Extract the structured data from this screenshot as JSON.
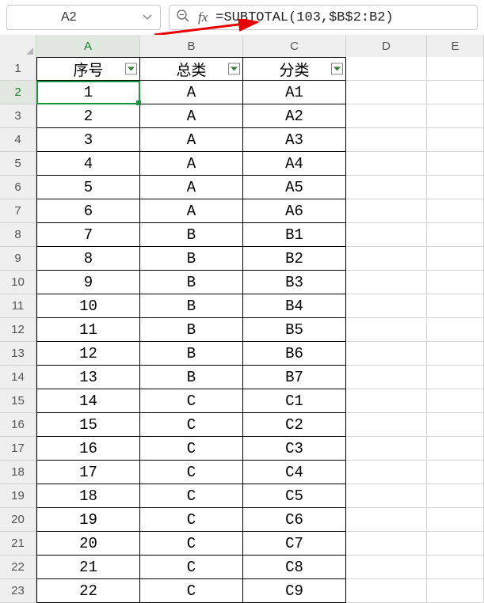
{
  "namebox": {
    "value": "A2"
  },
  "formula": {
    "text": "=SUBTOTAL(103,$B$2:B2)"
  },
  "columns": [
    "A",
    "B",
    "C",
    "D",
    "E"
  ],
  "headers": {
    "A": "序号",
    "B": "总类",
    "C": "分类"
  },
  "rows": [
    {
      "n": "1",
      "a": "序号",
      "b": "总类",
      "c": "分类",
      "isHeader": true
    },
    {
      "n": "2",
      "a": "1",
      "b": "A",
      "c": "A1"
    },
    {
      "n": "3",
      "a": "2",
      "b": "A",
      "c": "A2"
    },
    {
      "n": "4",
      "a": "3",
      "b": "A",
      "c": "A3"
    },
    {
      "n": "5",
      "a": "4",
      "b": "A",
      "c": "A4"
    },
    {
      "n": "6",
      "a": "5",
      "b": "A",
      "c": "A5"
    },
    {
      "n": "7",
      "a": "6",
      "b": "A",
      "c": "A6"
    },
    {
      "n": "8",
      "a": "7",
      "b": "B",
      "c": "B1"
    },
    {
      "n": "9",
      "a": "8",
      "b": "B",
      "c": "B2"
    },
    {
      "n": "10",
      "a": "9",
      "b": "B",
      "c": "B3"
    },
    {
      "n": "11",
      "a": "10",
      "b": "B",
      "c": "B4"
    },
    {
      "n": "12",
      "a": "11",
      "b": "B",
      "c": "B5"
    },
    {
      "n": "13",
      "a": "12",
      "b": "B",
      "c": "B6"
    },
    {
      "n": "14",
      "a": "13",
      "b": "B",
      "c": "B7"
    },
    {
      "n": "15",
      "a": "14",
      "b": "C",
      "c": "C1"
    },
    {
      "n": "16",
      "a": "15",
      "b": "C",
      "c": "C2"
    },
    {
      "n": "17",
      "a": "16",
      "b": "C",
      "c": "C3"
    },
    {
      "n": "18",
      "a": "17",
      "b": "C",
      "c": "C4"
    },
    {
      "n": "19",
      "a": "18",
      "b": "C",
      "c": "C5"
    },
    {
      "n": "20",
      "a": "19",
      "b": "C",
      "c": "C6"
    },
    {
      "n": "21",
      "a": "20",
      "b": "C",
      "c": "C7"
    },
    {
      "n": "22",
      "a": "21",
      "b": "C",
      "c": "C8"
    },
    {
      "n": "23",
      "a": "22",
      "b": "C",
      "c": "C9"
    }
  ],
  "selection": {
    "row": 2,
    "col": "A"
  }
}
